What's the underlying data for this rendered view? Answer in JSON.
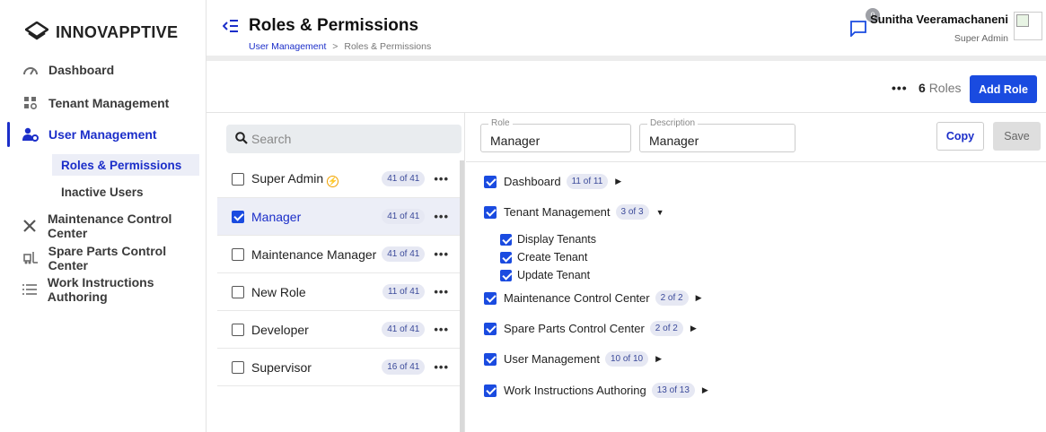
{
  "brand": {
    "name": "INNOVAPPTIVE"
  },
  "sidebar": {
    "items": [
      {
        "label": "Dashboard",
        "icon": "dashboard-gauge-icon"
      },
      {
        "label": "Tenant Management",
        "icon": "tenant-grid-icon"
      },
      {
        "label": "User Management",
        "icon": "users-gear-icon",
        "active": true
      },
      {
        "label": "Maintenance Control Center",
        "icon": "tools-icon"
      },
      {
        "label": "Spare Parts Control Center",
        "icon": "forklift-icon"
      },
      {
        "label": "Work Instructions Authoring",
        "icon": "list-icon"
      }
    ],
    "sub_items": [
      {
        "label": "Roles & Permissions",
        "active": true
      },
      {
        "label": "Inactive Users"
      }
    ]
  },
  "header": {
    "title": "Roles & Permissions",
    "breadcrumb": {
      "parent": "User Management",
      "separator": ">",
      "current": "Roles & Permissions"
    },
    "notification_count": "0",
    "user_name": "Sunitha Veeramachaneni",
    "user_role": "Super Admin"
  },
  "toolbar": {
    "more": "•••",
    "roles_count": "6",
    "roles_label": "Roles",
    "add_role_label": "Add Role"
  },
  "search": {
    "placeholder": "Search"
  },
  "roles": [
    {
      "name": "Super Admin",
      "count": "41 of 41",
      "checked": false,
      "badge": true
    },
    {
      "name": "Manager",
      "count": "41 of 41",
      "checked": true,
      "selected": true
    },
    {
      "name": "Maintenance Manager",
      "count": "41 of 41",
      "checked": false
    },
    {
      "name": "New Role",
      "count": "11 of 41",
      "checked": false
    },
    {
      "name": "Developer",
      "count": "41 of 41",
      "checked": false
    },
    {
      "name": "Supervisor",
      "count": "16 of 41",
      "checked": false
    }
  ],
  "editor": {
    "role_label": "Role",
    "role_value": "Manager",
    "description_label": "Description",
    "description_value": "Manager",
    "copy_label": "Copy",
    "save_label": "Save"
  },
  "permissions": [
    {
      "name": "Dashboard",
      "count": "11 of 11",
      "expanded": false
    },
    {
      "name": "Tenant Management",
      "count": "3 of 3",
      "expanded": true,
      "children": [
        "Display Tenants",
        "Create Tenant",
        "Update Tenant"
      ]
    },
    {
      "name": "Maintenance Control Center",
      "count": "2 of 2",
      "expanded": false
    },
    {
      "name": "Spare Parts Control Center",
      "count": "2 of 2",
      "expanded": false
    },
    {
      "name": "User Management",
      "count": "10 of 10",
      "expanded": false
    },
    {
      "name": "Work Instructions Authoring",
      "count": "13 of 13",
      "expanded": false
    }
  ],
  "colors": {
    "primary": "#1a4be0",
    "active_text": "#1b2ec9",
    "selected_bg": "#eceef7",
    "pill_bg": "#e6e8f3"
  }
}
